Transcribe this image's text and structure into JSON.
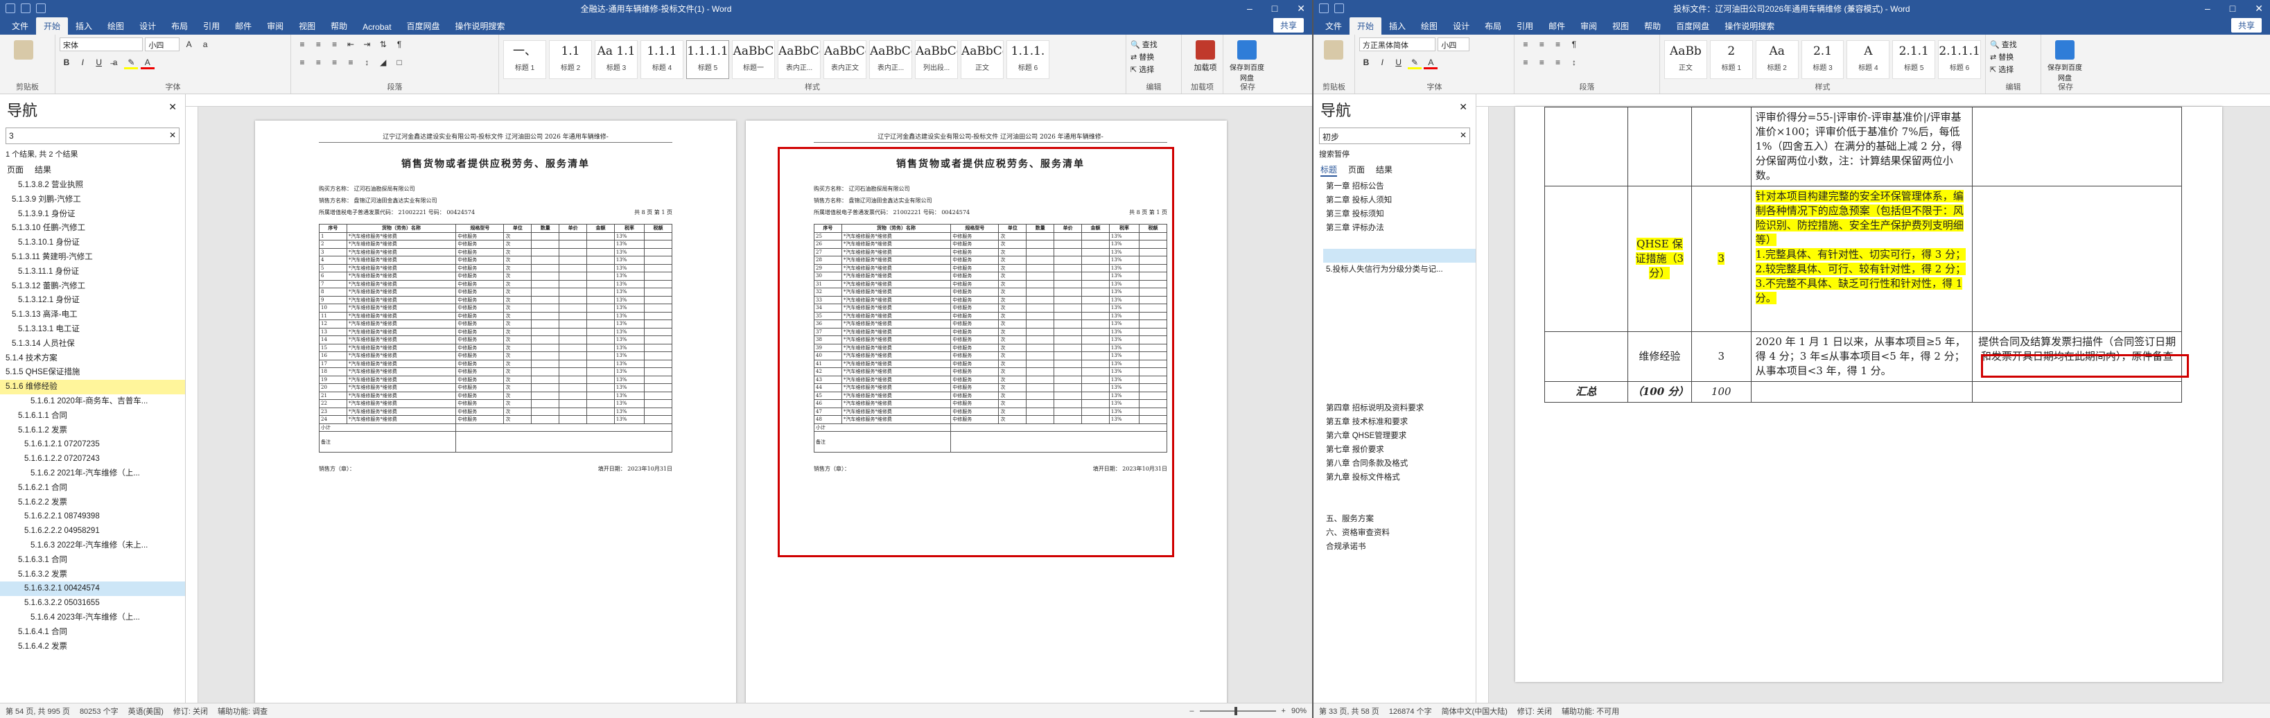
{
  "left": {
    "doc_title": "全融达-通用车辆维修-投标文件(1) - Word",
    "share_label": "共享",
    "tabs": [
      "文件",
      "开始",
      "插入",
      "绘图",
      "设计",
      "布局",
      "引用",
      "邮件",
      "审阅",
      "视图",
      "帮助",
      "Acrobat",
      "百度网盘",
      "操作说明搜索"
    ],
    "font_name": "宋体",
    "font_size": "小四",
    "styles": [
      {
        "preview": "一、",
        "name": "标题 1"
      },
      {
        "preview": "1.1",
        "name": "标题 2"
      },
      {
        "preview": "Aa 1.1",
        "name": "标题 3"
      },
      {
        "preview": "1.1.1",
        "name": "标题 4"
      },
      {
        "preview": "1.1.1.1",
        "name": "标题 5"
      },
      {
        "preview": "AaBbC",
        "name": "标题一"
      },
      {
        "preview": "AaBbCcI",
        "name": "表内正..."
      },
      {
        "preview": "AaBbCcDd",
        "name": "表内正文"
      },
      {
        "preview": "AaBbCcDd",
        "name": "表内正..."
      },
      {
        "preview": "AaBbCcDd",
        "name": "列出段..."
      },
      {
        "preview": "AaBbCcDd",
        "name": "正文"
      },
      {
        "preview": "1.1.1.",
        "name": "标题 6"
      }
    ],
    "group_labels": {
      "clipboard": "剪贴板",
      "font": "字体",
      "paragraph": "段落",
      "styles": "样式",
      "editing": "编辑",
      "signature": "加载项",
      "save": "保存"
    },
    "editing": [
      "查找",
      "替换",
      "选择"
    ],
    "addin_label": "加载项",
    "save_label": "保存到百度网盘",
    "nav": {
      "title": "导航",
      "search_value": "3",
      "result_text": "1 个结果, 共 2 个结果",
      "tabs": [
        "页面",
        "结果"
      ],
      "tree": [
        "5.1.3.8.2 营业执照",
        "5.1.3.9 刘鹏-汽修工",
        "5.1.3.9.1 身份证",
        "5.1.3.10 任鹏-汽修工",
        "5.1.3.10.1 身份证",
        "5.1.3.11 黄建明-汽修工",
        "5.1.3.11.1 身份证",
        "5.1.3.12 蕾鹏-汽修工",
        "5.1.3.12.1 身份证",
        "5.1.3.13 高泽-电工",
        "5.1.3.13.1 电工证",
        "5.1.3.14 人员社保",
        "5.1.4 技术方案",
        "5.1.5 QHSE保证措施",
        "5.1.6 维修经验",
        "5.1.6.1 2020年-商务车、吉普车...",
        "5.1.6.1.1 合同",
        "5.1.6.1.2 发票",
        "5.1.6.1.2.1 07207235",
        "5.1.6.1.2.2 07207243",
        "5.1.6.2 2021年-汽车维修（上...",
        "5.1.6.2.1 合同",
        "5.1.6.2.2 发票",
        "5.1.6.2.2.1 08749398",
        "5.1.6.2.2.2 04958291",
        "5.1.6.3 2022年-汽车维修（未上...",
        "5.1.6.3.1 合同",
        "5.1.6.3.2 发票",
        "5.1.6.3.2.1 00424574",
        "5.1.6.3.2.2 05031655",
        "5.1.6.4 2023年-汽车维修（上...",
        "5.1.6.4.1 合同",
        "5.1.6.4.2 发票"
      ]
    },
    "page_header": "辽宁辽河金鑫达建设实业有限公司-投标文件          辽河油田公司 2026 年通用车辆维修-",
    "invoice": {
      "title": "销售货物或者提供应税劳务、服务清单",
      "buyer": "购买方名称：  辽河石油勘探局有限公司",
      "seller": "销售方名称：  盘锦辽河油田金鑫达实业有限公司",
      "taxno": "所属增值税电子普通发票代码：  21002221  号码：  00424574",
      "page_label": "共 8 页  第 1 页",
      "cols": [
        "序号",
        "货物（劳务）名称",
        "规格型号",
        "单位",
        "数量",
        "单价",
        "金额",
        "税率",
        "税额"
      ],
      "item_name": "*汽车维修服务*维修费",
      "item_spec": "中修服务",
      "unit": "次",
      "rate": "13%",
      "total_label": "小计",
      "remark": "备注",
      "footer_left": "销售方（章）：",
      "footer_right": "填开日期：  2023年10月31日"
    },
    "status": {
      "page": "第 54 页, 共 995 页",
      "words": "80253 个字",
      "lang": "英语(美国)",
      "track": "修订: 关闭",
      "access": "辅助功能: 调查",
      "zoom": "90%"
    }
  },
  "right": {
    "doc_title": "投标文件：辽河油田公司2026年通用车辆维修 (兼容模式) - Word",
    "share_label": "共享",
    "tabs": [
      "文件",
      "开始",
      "插入",
      "绘图",
      "设计",
      "布局",
      "引用",
      "邮件",
      "审阅",
      "视图",
      "帮助",
      "百度网盘",
      "操作说明搜索"
    ],
    "font_name": "方正黑体简体",
    "font_size": "小四",
    "styles": [
      {
        "preview": "AaBb",
        "name": "正文"
      },
      {
        "preview": "2",
        "name": "标题 1"
      },
      {
        "preview": "Aa",
        "name": "标题 2"
      },
      {
        "preview": "2.1",
        "name": "标题 3"
      },
      {
        "preview": "A",
        "name": "标题 4"
      },
      {
        "preview": "2.1.1",
        "name": "标题 5"
      },
      {
        "preview": "2.1.1.1",
        "name": "标题 6"
      }
    ],
    "group_labels": {
      "clipboard": "剪贴板",
      "font": "字体",
      "paragraph": "段落",
      "styles": "样式",
      "editing": "编辑",
      "save": "保存"
    },
    "editing": [
      "查找",
      "替换",
      "选择"
    ],
    "save_label": "保存到百度网盘",
    "nav": {
      "title": "导航",
      "search_value": "初步",
      "result_text": "搜索暂停",
      "tabs": [
        "标题",
        "页面",
        "结果"
      ],
      "tree": [
        "第一章 招标公告",
        "第二章 投标人须知",
        "第三章 投标须知",
        "第三章 评标办法",
        "",
        "",
        "5.投标人失信行为分级分类与记...",
        "",
        "",
        "",
        "",
        "",
        "",
        "",
        "",
        "",
        "第四章 招标说明及资料要求",
        "第五章 技术标准和要求",
        "第六章 QHSE管理要求",
        "第七章 报价要求",
        "第八章 合同条款及格式",
        "第九章 投标文件格式",
        "",
        "",
        "五、服务方案",
        "六、资格审查资料",
        "合规承诺书"
      ]
    },
    "cells": {
      "scoring_top": "评审价得分=55-|评审价-评审基准价|/评审基准价×100；评审价低于基准价 7%后，每低 1%（四舍五入）在满分的基础上减 2 分，得分保留两位小数，注：计算结果保留两位小数。",
      "qhse_label": "QHSE 保证措施（3 分）",
      "qhse_score": "3",
      "qhse_text_1": "针对本项目构建完整的安全环保管理体系，编制各种情况下的应急预案（包括但不限于：风险识别、防控措施、安全生产保护费列支明细等）",
      "qhse_text_2": "1.完整具体、有针对性、切实可行，得 3 分；",
      "qhse_text_3": "2.较完整具体、可行、较有针对性，得 2 分；",
      "qhse_text_4": "3.不完整不具体、缺乏可行性和针对性，得 1 分。",
      "exp_label": "维修经验",
      "exp_score": "3",
      "exp_text": "2020 年 1 月 1 日以来，从事本项目≥5 年，得 4 分；3 年≤从事本项目<5 年，得 2 分；从事本项目<3 年，得 1 分。",
      "exp_note": "提供合同及结算发票扫描件（合同签订日期和发票开具日期均在此期间内），原件备查",
      "sum_label": "汇总",
      "sum_range": "（100 分）",
      "sum_score": "100"
    },
    "status": {
      "page": "第 33 页, 共 58 页",
      "words": "126874 个字",
      "lang": "简体中文(中国大陆)",
      "track": "修订: 关闭",
      "access": "辅助功能: 不可用"
    }
  },
  "colors": {
    "accent": "#2b579a",
    "highlight": "#ffff00",
    "annotation": "#d00000"
  }
}
